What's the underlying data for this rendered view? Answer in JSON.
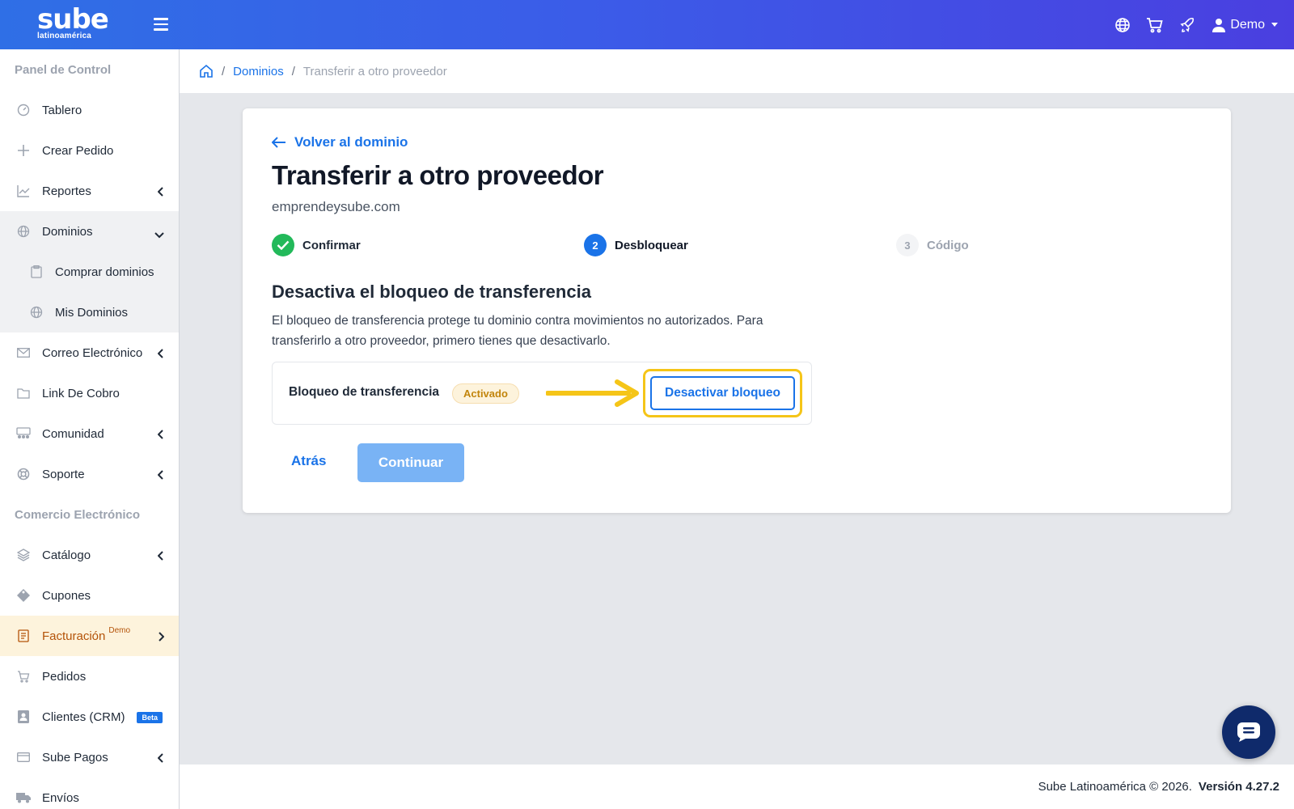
{
  "brand": {
    "name": "sube",
    "tagline": "latinoamérica"
  },
  "topbar": {
    "icons": [
      "globe-icon",
      "cart-icon",
      "rocket-icon",
      "user-icon"
    ],
    "user_label": "Demo"
  },
  "sidebar": {
    "sections": {
      "panel": "Panel de Control",
      "ecommerce": "Comercio Electrónico"
    },
    "items": {
      "tablero": "Tablero",
      "crear_pedido": "Crear Pedido",
      "reportes": "Reportes",
      "dominios": "Dominios",
      "comprar_dominios": "Comprar dominios",
      "mis_dominios": "Mis Dominios",
      "correo": "Correo Electrónico",
      "link_cobro": "Link De Cobro",
      "comunidad": "Comunidad",
      "soporte": "Soporte",
      "catalogo": "Catálogo",
      "cupones": "Cupones",
      "facturacion": "Facturación",
      "facturacion_badge": "Demo",
      "pedidos": "Pedidos",
      "clientes": "Clientes (CRM)",
      "clientes_badge": "Beta",
      "sube_pagos": "Sube Pagos",
      "envios": "Envíos"
    }
  },
  "breadcrumb": {
    "parent": "Dominios",
    "current": "Transferir a otro proveedor"
  },
  "card": {
    "back_label": "Volver al dominio",
    "title": "Transferir a otro proveedor",
    "domain": "emprendeysube.com",
    "steps": [
      {
        "number": "1",
        "label": "Confirmar",
        "state": "done"
      },
      {
        "number": "2",
        "label": "Desbloquear",
        "state": "current"
      },
      {
        "number": "3",
        "label": "Código",
        "state": "pending"
      }
    ],
    "section_title": "Desactiva el bloqueo de transferencia",
    "section_desc": "El bloqueo de transferencia protege tu dominio contra movimientos no autorizados. Para transferirlo a otro proveedor, primero tienes que desactivarlo.",
    "lock_label": "Bloqueo de transferencia",
    "lock_status": "Activado",
    "unlock_button": "Desactivar bloqueo",
    "back_button": "Atrás",
    "continue_button": "Continuar"
  },
  "footer": {
    "copyright": "Sube Latinoamérica © 2026.",
    "version": "Versión 4.27.2"
  },
  "colors": {
    "accent": "#1a73e8",
    "success": "#22b95a",
    "highlight": "#f5c518",
    "active_menu": "#b45309"
  }
}
